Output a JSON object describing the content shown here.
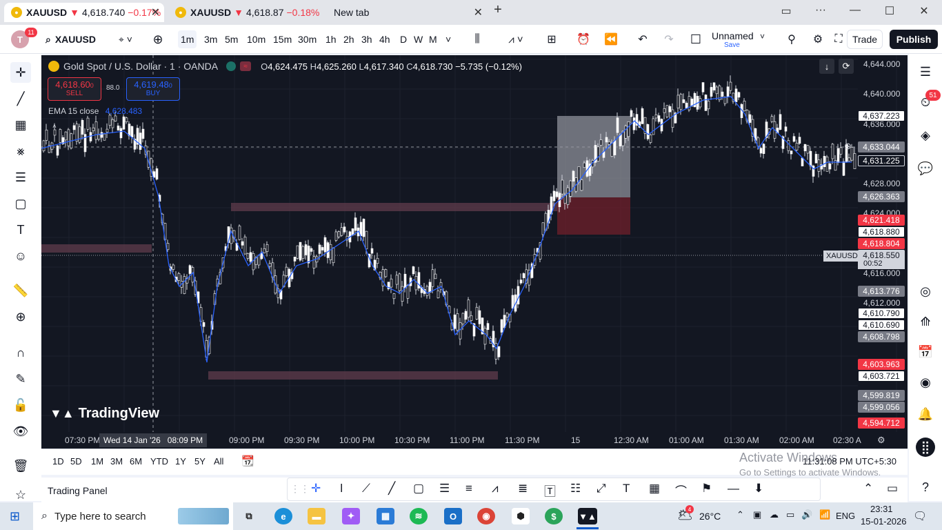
{
  "browser": {
    "tabs": [
      {
        "symbol": "XAUUSD",
        "arrow": "▼",
        "price": "4,618.740",
        "change": "−0.17%",
        "active": true
      },
      {
        "symbol": "XAUUSD",
        "arrow": "▼",
        "price": "4,618.87",
        "change": "−0.18%",
        "active": false
      },
      {
        "title": "New tab"
      }
    ],
    "new_tab": "+"
  },
  "toolbar": {
    "avatar_letter": "T",
    "avatar_badge": "11",
    "symbol": "XAUUSD",
    "intervals": [
      "1m",
      "3m",
      "5m",
      "10m",
      "15m",
      "30m",
      "1h",
      "2h",
      "3h",
      "4h",
      "D",
      "W",
      "M"
    ],
    "selected_interval": "1m",
    "layout_name": "Unnamed",
    "save_label": "Save",
    "trade_label": "Trade",
    "publish_label": "Publish"
  },
  "chart": {
    "title": "Gold Spot / U.S. Dollar · 1 · OANDA",
    "ohlc": {
      "o_label": "O",
      "o": "4,624.475",
      "h_label": "H",
      "h": "4,625.260",
      "l_label": "L",
      "l": "4,617.340",
      "c_label": "C",
      "c": "4,618.730",
      "change": "−5.735 (−0.12%)"
    },
    "sell_price": "4,618.60",
    "sell_sup": "0",
    "sell_label": "SELL",
    "spread": "88.0",
    "buy_price": "4,619.48",
    "buy_sup": "0",
    "buy_label": "BUY",
    "ema_label": "EMA 15 close",
    "ema_value": "4,628.483",
    "watermark": "TradingView",
    "crosshair_time": "Wed 14 Jan '26",
    "crosshair_clock": "08:09 PM",
    "symbol_tag": "XAUUSD",
    "countdown": "00:52",
    "time_ticks": [
      "07:30 PM",
      "09:00 PM",
      "09:30 PM",
      "10:00 PM",
      "10:30 PM",
      "11:00 PM",
      "11:30 PM",
      "15",
      "12:30 AM",
      "01:00 AM",
      "01:30 AM",
      "02:00 AM",
      "02:30 A"
    ],
    "price_ticks": [
      "4,644.000",
      "4,640.000",
      "4,636.000",
      "4,628.000",
      "4,624.000",
      "4,616.000",
      "4,612.000"
    ],
    "price_labels": [
      {
        "text": "4,637.223",
        "style": "white"
      },
      {
        "text": "4,633.044",
        "style": "gray"
      },
      {
        "text": "4,631.225",
        "style": "dark"
      },
      {
        "text": "4,626.363",
        "style": "gray"
      },
      {
        "text": "4,621.418",
        "style": "red"
      },
      {
        "text": "4,618.880",
        "style": "white"
      },
      {
        "text": "4,618.804",
        "style": "red"
      },
      {
        "text": "4,618.550",
        "style": "light"
      },
      {
        "text": "4,613.776",
        "style": "gray"
      },
      {
        "text": "4,610.790",
        "style": "white"
      },
      {
        "text": "4,610.690",
        "style": "white"
      },
      {
        "text": "4,608.798",
        "style": "gray"
      },
      {
        "text": "4,603.963",
        "style": "red"
      },
      {
        "text": "4,603.721",
        "style": "white"
      },
      {
        "text": "4,599.819",
        "style": "gray"
      },
      {
        "text": "4,599.056",
        "style": "gray"
      },
      {
        "text": "4,594.712",
        "style": "red"
      }
    ]
  },
  "range_bar": {
    "ranges": [
      "1D",
      "5D",
      "1M",
      "3M",
      "6M",
      "YTD",
      "1Y",
      "5Y",
      "All"
    ],
    "clock": "11:31:08 PM",
    "timezone": "UTC+5:30",
    "activate_title": "Activate Windows",
    "activate_sub": "Go to Settings to activate Windows."
  },
  "bottom": {
    "trading_panel": "Trading Panel"
  },
  "right_sidebar": {
    "alerts_badge": "51"
  },
  "taskbar": {
    "search_placeholder": "Type here to search",
    "weather": "26°C",
    "weather_badge": "4",
    "language": "ENG",
    "time": "23:31",
    "date": "15-01-2026",
    "notif_badge": "1"
  },
  "colors": {
    "up": "#ffffff",
    "down": "#ffffff",
    "ema": "#2962ff",
    "red_label": "#f23645",
    "chart_bg": "#131722"
  }
}
